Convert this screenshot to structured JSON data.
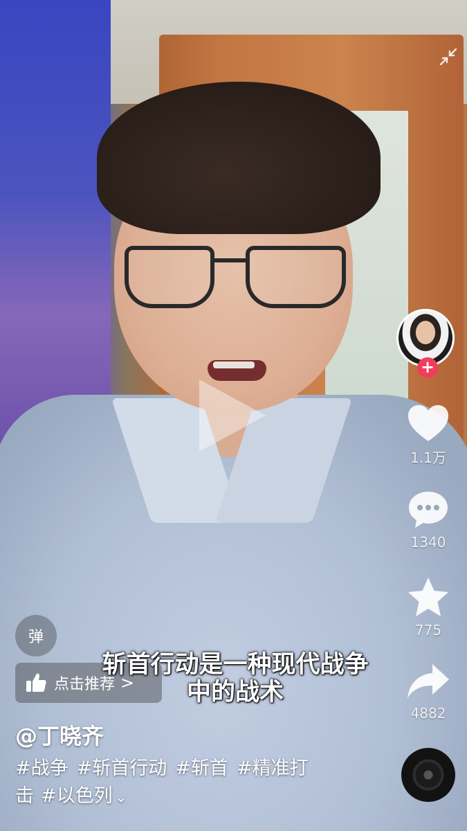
{
  "video": {
    "subtitle_line1": "斩首行动是一种现代战争",
    "subtitle_line2": "中的战术"
  },
  "author": {
    "username": "@丁晓齐",
    "follow_label": "+"
  },
  "tags": [
    "#战争",
    "#斩首行动",
    "#斩首",
    "#精准打",
    "击",
    "#以色列"
  ],
  "actions": {
    "likes": "1.1万",
    "comments": "1340",
    "favorites": "775",
    "shares": "4882"
  },
  "controls": {
    "danmu_label": "弹",
    "recommend_label": "点击推荐",
    "recommend_chevron": ">",
    "more_chevron": "⌄"
  },
  "colors": {
    "follow_button": "#f23d5a",
    "text": "#ffffff"
  },
  "icons": [
    "play-icon",
    "collapse-icon",
    "heart-icon",
    "comment-icon",
    "star-icon",
    "share-icon",
    "music-disc-icon",
    "thumbs-up-icon"
  ]
}
